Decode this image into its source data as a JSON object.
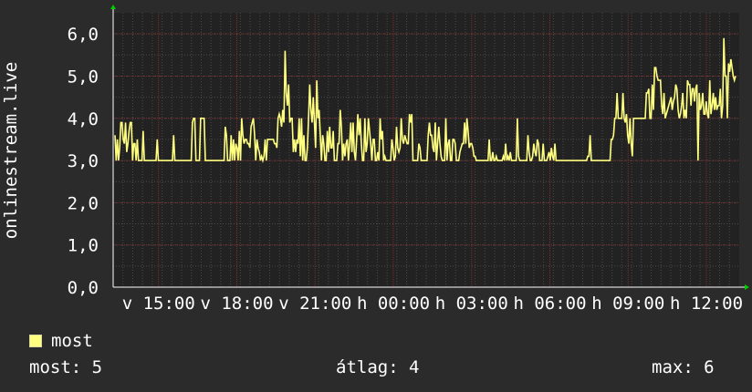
{
  "chart_data": {
    "type": "line",
    "title": "",
    "ylabel": "onlinestream.live",
    "xlabel": "",
    "ylim": [
      0,
      6.5
    ],
    "yticks": [
      "0,0",
      "1,0",
      "2,0",
      "3,0",
      "4,0",
      "5,0",
      "6,0"
    ],
    "xticks": [
      "v 15:00",
      "v 18:00",
      "v 21:00",
      "h 00:00",
      "h 03:00",
      "h 06:00",
      "h 09:00",
      "h 12:00"
    ],
    "grid": true,
    "legend_position": "bottom-left",
    "series": [
      {
        "name": "most",
        "color": "#ffff80",
        "values": [
          3.6,
          3.0,
          3.5,
          3.0,
          3.3,
          3.9,
          3.9,
          3.5,
          3.4,
          3.9,
          3.2,
          3.4,
          3.7,
          3.9,
          3.9,
          3.0,
          3.4,
          3.4,
          3.0,
          3.5,
          3.0,
          3.0,
          3.0,
          3.0,
          3.7,
          3.0,
          3.0,
          3.0,
          3.0,
          3.0,
          3.0,
          3.0,
          3.0,
          3.0,
          3.0,
          3.0,
          3.5,
          3.0,
          3.0,
          3.0,
          3.0,
          3.0,
          3.0,
          3.0,
          3.0,
          3.0,
          3.0,
          3.0,
          3.0,
          3.0,
          3.6,
          3.0,
          3.0,
          3.0,
          3.0,
          3.0,
          3.0,
          3.0,
          3.0,
          3.0,
          3.0,
          3.0,
          3.0,
          3.0,
          3.0,
          3.0,
          3.9,
          4.0,
          4.0,
          3.0,
          3.0,
          3.0,
          3.0,
          4.0,
          4.0,
          4.0,
          4.0,
          3.0,
          3.0,
          3.0,
          3.0,
          3.0,
          3.0,
          3.0,
          3.0,
          3.0,
          3.0,
          3.0,
          3.0,
          3.0,
          3.0,
          3.0,
          3.0,
          3.0,
          3.8,
          3.6,
          3.0,
          3.0,
          3.0,
          3.6,
          3.0,
          3.5,
          3.0,
          3.4,
          3.3,
          3.0,
          3.7,
          3.0,
          4.0,
          3.6,
          3.4,
          3.5,
          3.5,
          3.4,
          3.4,
          3.3,
          3.8,
          3.9,
          4.0,
          3.6,
          3.0,
          3.5,
          3.3,
          3.2,
          3.0,
          3.1,
          3.0,
          3.1,
          3.5,
          3.0,
          3.5,
          3.5,
          3.5,
          3.5,
          3.5,
          3.5,
          3.4,
          3.4,
          3.3,
          4.0,
          4.1,
          4.0,
          3.8,
          4.2,
          3.9,
          5.6,
          4.6,
          4.3,
          4.8,
          3.9,
          4.0,
          4.0,
          3.2,
          3.5,
          3.2,
          3.5,
          3.4,
          4.0,
          3.1,
          4.0,
          3.0,
          3.6,
          3.0,
          3.0,
          3.3,
          4.0,
          4.8,
          4.2,
          3.9,
          4.5,
          3.9,
          3.3,
          4.9,
          4.0,
          4.2,
          3.6,
          3.0,
          3.6,
          3.4,
          3.0,
          3.0,
          3.7,
          3.2,
          3.8,
          3.3,
          3.3,
          3.7,
          3.0,
          3.0,
          3.0,
          3.4,
          3.4,
          4.2,
          3.8,
          3.0,
          3.4,
          3.1,
          3.4,
          3.5,
          3.0,
          3.4,
          3.9,
          3.2,
          3.9,
          3.2,
          3.0,
          3.5,
          4.1,
          3.6,
          4.0,
          3.4,
          3.0,
          3.0,
          4.0,
          3.2,
          3.4,
          4.0,
          3.7,
          3.4,
          3.0,
          3.5,
          3.5,
          3.0,
          3.0,
          3.2,
          3.0,
          4.0,
          3.5,
          3.7,
          3.0,
          3.1,
          3.0,
          3.0,
          3.0,
          3.0,
          3.0,
          3.5,
          3.3,
          3.0,
          3.1,
          3.8,
          3.3,
          3.2,
          3.3,
          4.0,
          3.5,
          3.4,
          3.6,
          3.5,
          3.4,
          3.4,
          4.1,
          3.9,
          4.1,
          3.0,
          3.0,
          3.0,
          3.0,
          3.0,
          3.4,
          3.3,
          3.0,
          3.0,
          3.0,
          3.0,
          3.0,
          3.0,
          3.6,
          3.9,
          3.6,
          3.6,
          3.3,
          3.2,
          3.9,
          3.0,
          3.4,
          3.8,
          3.4,
          3.1,
          3.0,
          3.0,
          3.0,
          4.0,
          3.0,
          3.4,
          3.5,
          3.0,
          3.0,
          3.5,
          3.5,
          3.4,
          3.0,
          3.0,
          3.0,
          3.2,
          3.3,
          3.4,
          3.4,
          3.9,
          3.4,
          4.0,
          3.7,
          3.3,
          3.4,
          3.4,
          3.3,
          3.1,
          3.1,
          3.0,
          3.0,
          3.0,
          3.0,
          3.0,
          3.0,
          3.0,
          3.0,
          3.0,
          3.0,
          3.0,
          3.5,
          3.0,
          3.0,
          3.2,
          3.0,
          3.0,
          3.1,
          3.0,
          3.0,
          3.0,
          3.0,
          3.0,
          3.1,
          3.0,
          3.4,
          3.0,
          3.1,
          3.0,
          3.2,
          3.0,
          3.0,
          3.0,
          3.0,
          3.0,
          4.0,
          3.1,
          3.0,
          3.0,
          3.0,
          3.0,
          3.0,
          3.0,
          3.0,
          3.6,
          3.2,
          3.0,
          3.0,
          3.1,
          3.4,
          3.2,
          3.1,
          3.5,
          3.4,
          3.0,
          3.0,
          3.0,
          3.4,
          3.0,
          3.0,
          3.0,
          3.1,
          3.2,
          3.0,
          3.3,
          3.1,
          3.0,
          3.4,
          3.0,
          3.0,
          3.0,
          3.0,
          3.0,
          3.0,
          3.0,
          3.0,
          3.0,
          3.0,
          3.0,
          3.0,
          3.0,
          3.0,
          3.0,
          3.0,
          3.0,
          3.0,
          3.0,
          3.0,
          3.0,
          3.0,
          3.0,
          3.0,
          3.0,
          3.0,
          3.0,
          3.1,
          3.1,
          3.6,
          3.0,
          3.0,
          3.0,
          3.0,
          3.0,
          3.0,
          3.0,
          3.0,
          3.0,
          3.0,
          3.0,
          3.0,
          3.0,
          3.0,
          3.0,
          3.0,
          3.0,
          3.5,
          3.5,
          3.6,
          4.0,
          4.0,
          4.6,
          4.0,
          4.0,
          4.0,
          4.0,
          4.6,
          4.0,
          3.9,
          4.1,
          3.6,
          3.4,
          4.0,
          3.4,
          3.1,
          4.0,
          4.0,
          4.0,
          4.0,
          4.0,
          4.0,
          4.0,
          4.0,
          4.0,
          4.0,
          4.0,
          4.6,
          4.6,
          4.7,
          4.0,
          4.0,
          4.8,
          4.2,
          5.2,
          5.2,
          5.0,
          4.9,
          4.9,
          4.9,
          4.3,
          4.1,
          4.6,
          4.0,
          4.1,
          4.2,
          4.3,
          4.4,
          4.5,
          4.2,
          4.4,
          4.5,
          4.8,
          4.7,
          4.2,
          4.0,
          4.1,
          4.3,
          4.6,
          4.0,
          4.2,
          4.0,
          4.9,
          4.8,
          4.8,
          4.3,
          4.7,
          4.7,
          4.4,
          4.7,
          4.8,
          3.0,
          4.6,
          4.2,
          4.3,
          4.6,
          4.1,
          4.1,
          4.4,
          4.1,
          4.0,
          4.9,
          4.1,
          4.3,
          4.6,
          4.2,
          4.5,
          4.2,
          4.3,
          4.3,
          4.7,
          4.0,
          4.3,
          5.9,
          5.0,
          5.0,
          4.0,
          5.3,
          5.1,
          5.4,
          5.2,
          5.0,
          4.9,
          5.0
        ]
      }
    ]
  },
  "legend": {
    "label": "most",
    "color": "#ffff80"
  },
  "stats": {
    "current_label": "most:",
    "current_value": "5",
    "average_label": "átlag:",
    "average_value": "4",
    "max_label": "max:",
    "max_value": "6"
  }
}
